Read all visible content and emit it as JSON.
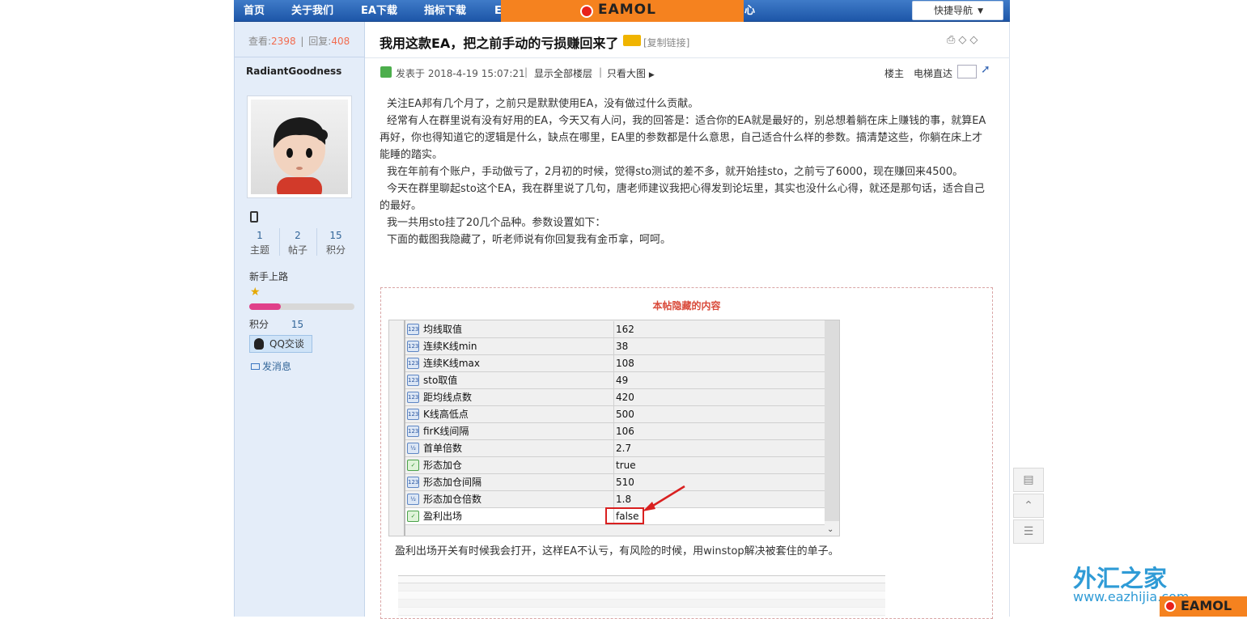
{
  "nav": {
    "items": [
      "首页",
      "关于我们",
      "EA下载",
      "指标下载",
      "E",
      "心"
    ],
    "quick_nav": "快捷导航"
  },
  "banner": {
    "logo_text": "EAMOL"
  },
  "sidebar": {
    "views_label": "查看:",
    "views": "2398",
    "replies_label": "回复:",
    "replies": "408",
    "username": "RadiantGoodness",
    "stats": [
      {
        "value": "1",
        "label": "主题"
      },
      {
        "value": "2",
        "label": "帖子"
      },
      {
        "value": "15",
        "label": "积分"
      }
    ],
    "rank": "新手上路",
    "points_label": "积分",
    "points": "15",
    "qq_button": "QQ交谈",
    "message_link": "发消息"
  },
  "post": {
    "title": "我用这款EA，把之前手动的亏损赚回来了",
    "copy_link": "[复制链接]",
    "posted_at": "发表于 2018-4-19 15:07:21",
    "show_all": "显示全部楼层",
    "only_images": "只看大图",
    "floor_label": "楼主",
    "elevator_label": "电梯直达",
    "paragraphs": [
      "关注EA邦有几个月了，之前只是默默使用EA，没有做过什么贡献。",
      "经常有人在群里说有没有好用的EA，今天又有人问，我的回答是：适合你的EA就是最好的，别总想着躺在床上赚钱的事，就算EA再好，你也得知道它的逻辑是什么，缺点在哪里，EA里的参数都是什么意思，自己适合什么样的参数。搞清楚这些，你躺在床上才能睡的踏实。",
      "我在年前有个账户，手动做亏了，2月初的时候，觉得sto测试的差不多，就开始挂sto，之前亏了6000，现在赚回来4500。",
      "今天在群里聊起sto这个EA，我在群里说了几句，唐老师建议我把心得发到论坛里，其实也没什么心得，就还是那句话，适合自己的最好。",
      "我一共用sto挂了20几个品种。参数设置如下：",
      "下面的截图我隐藏了，听老师说有你回复我有金币拿，呵呵。"
    ],
    "hidden_title": "本帖隐藏的内容",
    "params": [
      {
        "name": "均线取值",
        "value": "162"
      },
      {
        "name": "连续K线min",
        "value": "38"
      },
      {
        "name": "连续K线max",
        "value": "108"
      },
      {
        "name": "sto取值",
        "value": "49"
      },
      {
        "name": "距均线点数",
        "value": "420"
      },
      {
        "name": "K线高低点",
        "value": "500"
      },
      {
        "name": "firK线间隔",
        "value": "106"
      },
      {
        "name": "首单倍数",
        "value": "2.7"
      },
      {
        "name": "形态加仓",
        "value": "true"
      },
      {
        "name": "形态加仓间隔",
        "value": "510"
      },
      {
        "name": "形态加仓倍数",
        "value": "1.8"
      },
      {
        "name": "盈利出场",
        "value": "false"
      }
    ],
    "after_table": "盈利出场开关有时候我会打开，这样EA不认亏，有风险的时候，用winstop解决被套住的单子。"
  },
  "watermark": {
    "brand": "外汇之家",
    "url": "www.eazhijia.com",
    "bottom_logo": "EAMOL"
  },
  "colors": {
    "nav": "#1d56a8",
    "banner": "#f5821f",
    "sidebar": "#e4edf9",
    "highlight": "#d92020"
  }
}
